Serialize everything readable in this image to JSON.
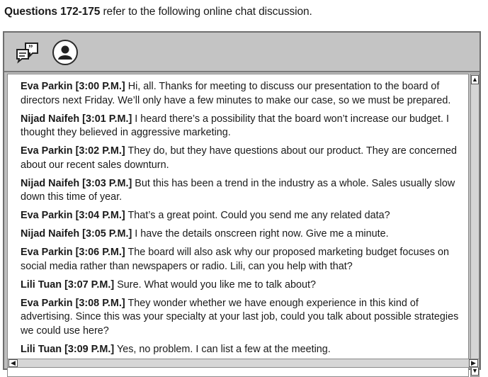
{
  "instruction": {
    "bold": "Questions 172-175",
    "rest": " refer to the following online chat discussion."
  },
  "toolbar": {
    "icons": [
      "chat-icon",
      "user-icon"
    ]
  },
  "messages": [
    {
      "who": "Eva Parkin [3:00 P.M.]",
      "text": " Hi, all. Thanks for meeting to discuss our presentation to the board of directors next Friday. We’ll only have a few minutes to make our case, so we must be prepared."
    },
    {
      "who": "Nijad Naifeh [3:01 P.M.]",
      "text": " I heard there’s a possibility that the board won’t increase our budget. I thought they believed in aggressive marketing."
    },
    {
      "who": "Eva Parkin [3:02 P.M.]",
      "text": " They do, but they have questions about our product. They are concerned about our recent sales downturn."
    },
    {
      "who": "Nijad Naifeh [3:03 P.M.]",
      "text": " But this has been a trend in the industry as a whole. Sales usually slow down this time of year."
    },
    {
      "who": "Eva Parkin [3:04 P.M.]",
      "text": " That’s a great point. Could you send me any related data?"
    },
    {
      "who": "Nijad Naifeh [3:05 P.M.]",
      "text": " I have the details onscreen right now. Give me a minute."
    },
    {
      "who": "Eva Parkin [3:06 P.M.]",
      "text": " The board will also ask why our proposed marketing budget focuses on social media rather than newspapers or radio. Lili, can you help with that?"
    },
    {
      "who": "Lili Tuan [3:07 P.M.]",
      "text": " Sure. What would you like me to talk about?"
    },
    {
      "who": "Eva Parkin [3:08 P.M.]",
      "text": " They wonder whether we have enough experience in this kind of advertising. Since this was your specialty at your last job, could you talk about possible strategies we could use here?"
    },
    {
      "who": "Lili Tuan [3:09 P.M.]",
      "text": " Yes, no problem. I can list a few at the meeting."
    }
  ],
  "scroll": {
    "up": "▲",
    "down": "▼",
    "left": "◀",
    "right": "▶"
  }
}
